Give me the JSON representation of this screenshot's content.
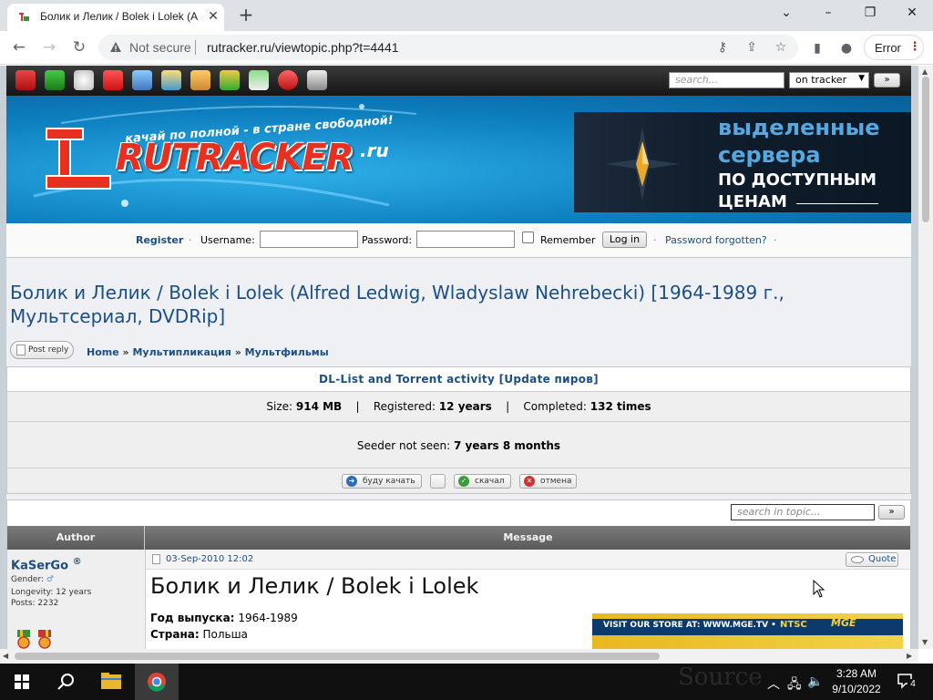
{
  "browser": {
    "tab_title": "Болик и Лелик / Bolek i Lolek (A",
    "not_secure": "Not secure",
    "url": "rutracker.ru/viewtopic.php?t=4441",
    "error_label": "Error"
  },
  "top_bar": {
    "search_placeholder": "search...",
    "scope_select": "on tracker",
    "go_label": "»"
  },
  "banner": {
    "slogan": "качай по полной - в стране свободной!",
    "logo": "RUTRACKER",
    "logo_suffix": ".ru",
    "ad_line1": "выделенные",
    "ad_line2": "сервера",
    "ad_line3": "ПО ДОСТУПНЫМ",
    "ad_line4": "ЦЕНАМ"
  },
  "login": {
    "register": "Register",
    "username_label": "Username:",
    "password_label": "Password:",
    "remember_label": "Remember",
    "login_button": "Log in",
    "forgot": "Password forgotten?"
  },
  "topic": {
    "title": "Болик и Лелик / Bolek i Lolek (Alfred Ledwig, Wladyslaw Nehrebecki) [1964-1989 г., Мультсериал, DVDRip]",
    "post_reply": "Post reply",
    "breadcrumbs": [
      "Home",
      "Мультипликация",
      "Мультфильмы"
    ]
  },
  "dl": {
    "header": "DL-List and Torrent activity",
    "update_link": "[Update пиров]",
    "size_label": "Size:",
    "size_value": "914 MB",
    "registered_label": "Registered:",
    "registered_value": "12 years",
    "completed_label": "Completed:",
    "completed_value": "132 times",
    "seeder_label": "Seeder not seen:",
    "seeder_value": "7 years 8 months",
    "actions": [
      "буду качать",
      "",
      "скачал",
      "отмена"
    ]
  },
  "posts": {
    "search_placeholder": "search in topic...",
    "go_label": "»",
    "col_author": "Author",
    "col_message": "Message",
    "author": {
      "name": "KaSerGo",
      "reg_mark": "®",
      "gender_label": "Gender:",
      "longevity": "Longevity: 12 years",
      "posts": "Posts: 2232"
    },
    "date": "03-Sep-2010 12:02",
    "quote": "Quote",
    "post_title": "Болик и Лелик / Bolek i Lolek",
    "year_label": "Год выпуска:",
    "year_value": "1964-1989",
    "country_label": "Страна:",
    "country_value": "Польша",
    "ad_text": "VISIT OUR STORE AT: WWW.MGE.TV  •",
    "ad_ntsc": "NTSC",
    "ad_logo": "MGE"
  },
  "taskbar": {
    "time": "3:28 AM",
    "date": "9/10/2022",
    "notifications": "4",
    "watermark": "Source"
  }
}
